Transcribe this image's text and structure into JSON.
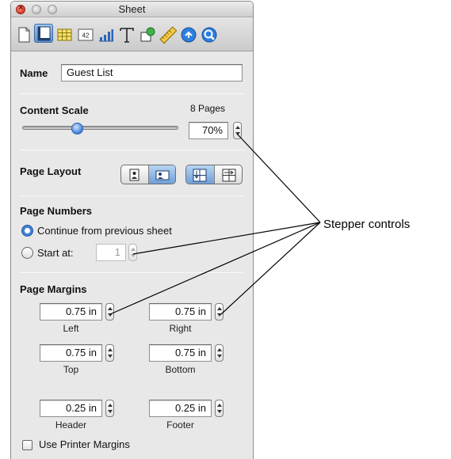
{
  "window": {
    "title": "Sheet"
  },
  "toolbar": {
    "icons": [
      "document-icon",
      "sheet-icon",
      "table-icon",
      "format-icon",
      "chart-icon",
      "text-icon",
      "shapes-icon",
      "measure-icon",
      "link-icon",
      "zoom-icon"
    ],
    "format_label": "42"
  },
  "name_section": {
    "label": "Name",
    "value": "Guest List"
  },
  "content_scale": {
    "label": "Content Scale",
    "pages": "8 Pages",
    "value": "70%",
    "slider_fraction": 0.35
  },
  "page_layout": {
    "label": "Page Layout"
  },
  "page_numbers": {
    "label": "Page Numbers",
    "option_continue": "Continue from previous sheet",
    "option_start": "Start at:",
    "start_value": "1",
    "selected": "continue"
  },
  "page_margins": {
    "label": "Page Margins",
    "left": {
      "value": "0.75 in",
      "label": "Left"
    },
    "right": {
      "value": "0.75 in",
      "label": "Right"
    },
    "top": {
      "value": "0.75 in",
      "label": "Top"
    },
    "bottom": {
      "value": "0.75 in",
      "label": "Bottom"
    },
    "header": {
      "value": "0.25 in",
      "label": "Header"
    },
    "footer": {
      "value": "0.25 in",
      "label": "Footer"
    }
  },
  "printer_margins": {
    "label": "Use Printer Margins",
    "checked": false
  },
  "annotation": {
    "text": "Stepper controls"
  },
  "colors": {
    "accent": "#3f7ed6",
    "selected_segment": "#6fa0d8"
  }
}
